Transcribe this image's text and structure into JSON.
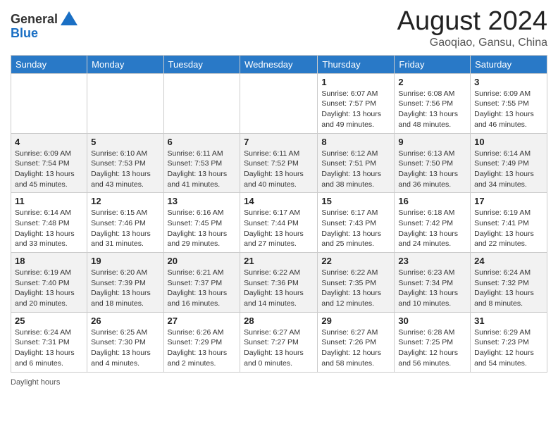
{
  "header": {
    "logo_general": "General",
    "logo_blue": "Blue",
    "title": "August 2024",
    "location": "Gaoqiao, Gansu, China"
  },
  "days_of_week": [
    "Sunday",
    "Monday",
    "Tuesday",
    "Wednesday",
    "Thursday",
    "Friday",
    "Saturday"
  ],
  "weeks": [
    [
      {
        "day": "",
        "detail": ""
      },
      {
        "day": "",
        "detail": ""
      },
      {
        "day": "",
        "detail": ""
      },
      {
        "day": "",
        "detail": ""
      },
      {
        "day": "1",
        "detail": "Sunrise: 6:07 AM\nSunset: 7:57 PM\nDaylight: 13 hours\nand 49 minutes."
      },
      {
        "day": "2",
        "detail": "Sunrise: 6:08 AM\nSunset: 7:56 PM\nDaylight: 13 hours\nand 48 minutes."
      },
      {
        "day": "3",
        "detail": "Sunrise: 6:09 AM\nSunset: 7:55 PM\nDaylight: 13 hours\nand 46 minutes."
      }
    ],
    [
      {
        "day": "4",
        "detail": "Sunrise: 6:09 AM\nSunset: 7:54 PM\nDaylight: 13 hours\nand 45 minutes."
      },
      {
        "day": "5",
        "detail": "Sunrise: 6:10 AM\nSunset: 7:53 PM\nDaylight: 13 hours\nand 43 minutes."
      },
      {
        "day": "6",
        "detail": "Sunrise: 6:11 AM\nSunset: 7:53 PM\nDaylight: 13 hours\nand 41 minutes."
      },
      {
        "day": "7",
        "detail": "Sunrise: 6:11 AM\nSunset: 7:52 PM\nDaylight: 13 hours\nand 40 minutes."
      },
      {
        "day": "8",
        "detail": "Sunrise: 6:12 AM\nSunset: 7:51 PM\nDaylight: 13 hours\nand 38 minutes."
      },
      {
        "day": "9",
        "detail": "Sunrise: 6:13 AM\nSunset: 7:50 PM\nDaylight: 13 hours\nand 36 minutes."
      },
      {
        "day": "10",
        "detail": "Sunrise: 6:14 AM\nSunset: 7:49 PM\nDaylight: 13 hours\nand 34 minutes."
      }
    ],
    [
      {
        "day": "11",
        "detail": "Sunrise: 6:14 AM\nSunset: 7:48 PM\nDaylight: 13 hours\nand 33 minutes."
      },
      {
        "day": "12",
        "detail": "Sunrise: 6:15 AM\nSunset: 7:46 PM\nDaylight: 13 hours\nand 31 minutes."
      },
      {
        "day": "13",
        "detail": "Sunrise: 6:16 AM\nSunset: 7:45 PM\nDaylight: 13 hours\nand 29 minutes."
      },
      {
        "day": "14",
        "detail": "Sunrise: 6:17 AM\nSunset: 7:44 PM\nDaylight: 13 hours\nand 27 minutes."
      },
      {
        "day": "15",
        "detail": "Sunrise: 6:17 AM\nSunset: 7:43 PM\nDaylight: 13 hours\nand 25 minutes."
      },
      {
        "day": "16",
        "detail": "Sunrise: 6:18 AM\nSunset: 7:42 PM\nDaylight: 13 hours\nand 24 minutes."
      },
      {
        "day": "17",
        "detail": "Sunrise: 6:19 AM\nSunset: 7:41 PM\nDaylight: 13 hours\nand 22 minutes."
      }
    ],
    [
      {
        "day": "18",
        "detail": "Sunrise: 6:19 AM\nSunset: 7:40 PM\nDaylight: 13 hours\nand 20 minutes."
      },
      {
        "day": "19",
        "detail": "Sunrise: 6:20 AM\nSunset: 7:39 PM\nDaylight: 13 hours\nand 18 minutes."
      },
      {
        "day": "20",
        "detail": "Sunrise: 6:21 AM\nSunset: 7:37 PM\nDaylight: 13 hours\nand 16 minutes."
      },
      {
        "day": "21",
        "detail": "Sunrise: 6:22 AM\nSunset: 7:36 PM\nDaylight: 13 hours\nand 14 minutes."
      },
      {
        "day": "22",
        "detail": "Sunrise: 6:22 AM\nSunset: 7:35 PM\nDaylight: 13 hours\nand 12 minutes."
      },
      {
        "day": "23",
        "detail": "Sunrise: 6:23 AM\nSunset: 7:34 PM\nDaylight: 13 hours\nand 10 minutes."
      },
      {
        "day": "24",
        "detail": "Sunrise: 6:24 AM\nSunset: 7:32 PM\nDaylight: 13 hours\nand 8 minutes."
      }
    ],
    [
      {
        "day": "25",
        "detail": "Sunrise: 6:24 AM\nSunset: 7:31 PM\nDaylight: 13 hours\nand 6 minutes."
      },
      {
        "day": "26",
        "detail": "Sunrise: 6:25 AM\nSunset: 7:30 PM\nDaylight: 13 hours\nand 4 minutes."
      },
      {
        "day": "27",
        "detail": "Sunrise: 6:26 AM\nSunset: 7:29 PM\nDaylight: 13 hours\nand 2 minutes."
      },
      {
        "day": "28",
        "detail": "Sunrise: 6:27 AM\nSunset: 7:27 PM\nDaylight: 13 hours\nand 0 minutes."
      },
      {
        "day": "29",
        "detail": "Sunrise: 6:27 AM\nSunset: 7:26 PM\nDaylight: 12 hours\nand 58 minutes."
      },
      {
        "day": "30",
        "detail": "Sunrise: 6:28 AM\nSunset: 7:25 PM\nDaylight: 12 hours\nand 56 minutes."
      },
      {
        "day": "31",
        "detail": "Sunrise: 6:29 AM\nSunset: 7:23 PM\nDaylight: 12 hours\nand 54 minutes."
      }
    ]
  ],
  "footer": {
    "daylight_hours": "Daylight hours"
  }
}
